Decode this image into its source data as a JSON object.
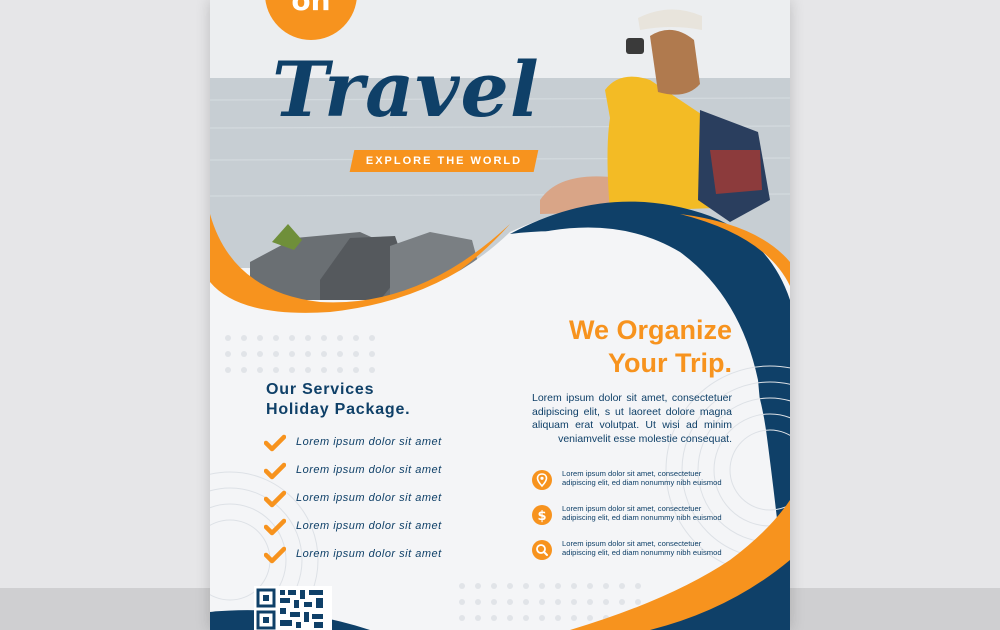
{
  "badge": {
    "text": "on"
  },
  "hero": {
    "title": "Travel",
    "tagline": "EXPLORE THE WORLD"
  },
  "headline": {
    "line1": "We Organize",
    "line2": "Your Trip."
  },
  "paragraph": "Lorem ipsum dolor sit amet, consectetuer adipiscing elit, s ut laoreet dolore magna aliquam erat volutpat. Ut wisi ad minim veniamvelit esse molestie consequat.",
  "services": {
    "title_line1": "Our Services",
    "title_line2": "Holiday Package.",
    "items": [
      "Lorem ipsum dolor sit amet",
      "Lorem ipsum dolor sit amet",
      "Lorem ipsum dolor sit amet",
      "Lorem ipsum dolor sit amet",
      "Lorem ipsum dolor sit amet"
    ]
  },
  "info": [
    {
      "icon": "location-pin-icon",
      "line1": "Lorem ipsum dolor sit amet, consectetuer",
      "line2": "adipiscing elit, ed diam nonummy nibh euismod"
    },
    {
      "icon": "dollar-icon",
      "line1": "Lorem ipsum dolor sit amet, consectetuer",
      "line2": "adipiscing elit, ed diam nonummy nibh euismod"
    },
    {
      "icon": "search-icon",
      "line1": "Lorem ipsum dolor sit amet, consectetuer",
      "line2": "adipiscing elit, ed diam nonummy nibh euismod"
    }
  ],
  "colors": {
    "orange": "#f7931e",
    "navy": "#0f4068",
    "background": "#f4f5f7"
  }
}
